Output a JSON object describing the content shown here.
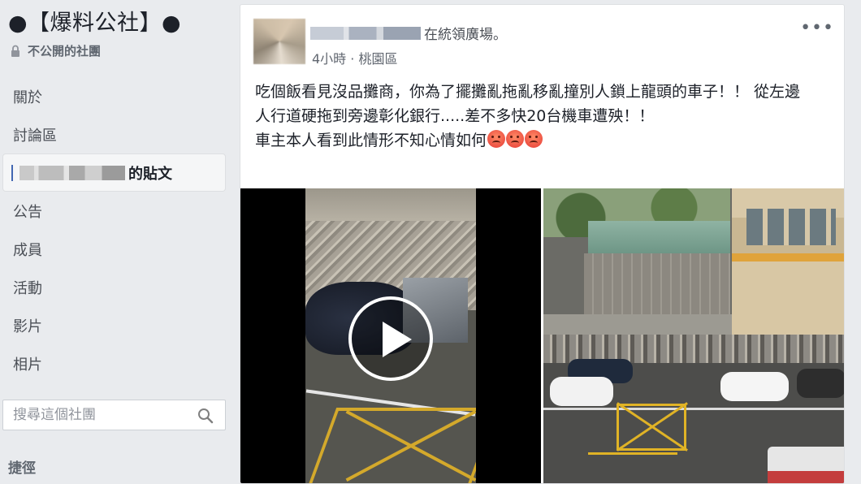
{
  "sidebar": {
    "group_title": "●【爆料公社】●",
    "privacy": "不公開的社團",
    "nav": {
      "about": "關於",
      "discussion": "討論區",
      "your_posts_suffix": "的貼文",
      "announcements": "公告",
      "members": "成員",
      "events": "活動",
      "videos": "影片",
      "photos": "相片"
    },
    "search_placeholder": "搜尋這個社團",
    "shortcuts": "捷徑"
  },
  "post": {
    "author_location_suffix": "在統領廣場。",
    "timestamp": "4小時",
    "separator": "·",
    "place": "桃園區",
    "more": "•••",
    "body_line1": "吃個飯看見沒品攤商，你為了擺攤亂拖亂移亂撞別人鎖上龍頭的車子！！ 從左邊人行道硬拖到旁邊彰化銀行.....差不多快20台機車遭殃！！",
    "body_line2": "車主本人看到此情形不知心情如何"
  }
}
